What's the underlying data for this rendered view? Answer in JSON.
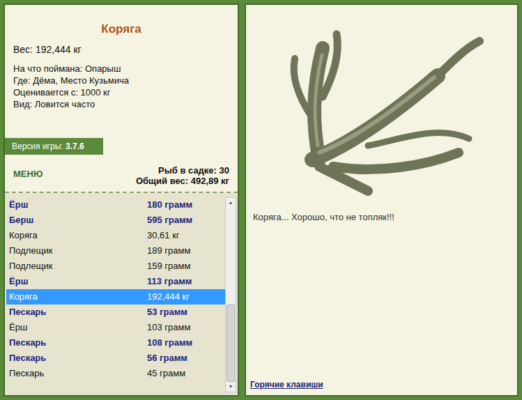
{
  "details": {
    "title": "Коряга",
    "weight": "Вес: 192,444 кг",
    "lines": [
      "На что поймана: Опарыш",
      "Где: Дёма, Место Кузьмича",
      "Оценивается с: 1000 кг",
      "Вид: Ловится часто"
    ]
  },
  "version": {
    "label": "Версия игры:",
    "value": "3.7.6"
  },
  "menu": "МЕНЮ",
  "stats": [
    "Рыб в садке: 30",
    "Общий вес: 492,89 кг"
  ],
  "catch": [
    {
      "name": "Ёрш",
      "weight": "180 грамм",
      "bold": true,
      "selected": false
    },
    {
      "name": "Берш",
      "weight": "595 грамм",
      "bold": true,
      "selected": false
    },
    {
      "name": "Коряга",
      "weight": "30,61 кг",
      "bold": false,
      "selected": false
    },
    {
      "name": "Подлещик",
      "weight": "189 грамм",
      "bold": false,
      "selected": false
    },
    {
      "name": "Подлещик",
      "weight": "159 грамм",
      "bold": false,
      "selected": false
    },
    {
      "name": "Ёрш",
      "weight": "113 грамм",
      "bold": true,
      "selected": false
    },
    {
      "name": "Коряга",
      "weight": "192,444 кг",
      "bold": false,
      "selected": true
    },
    {
      "name": "Пескарь",
      "weight": "53 грамм",
      "bold": true,
      "selected": false
    },
    {
      "name": "Ёрш",
      "weight": "103 грамм",
      "bold": false,
      "selected": false
    },
    {
      "name": "Пескарь",
      "weight": "108 грамм",
      "bold": true,
      "selected": false
    },
    {
      "name": "Пескарь",
      "weight": "56 грамм",
      "bold": true,
      "selected": false
    },
    {
      "name": "Пескарь",
      "weight": "45 грамм",
      "bold": false,
      "selected": false
    }
  ],
  "scrollbar": {
    "up": "▲",
    "down": "▼",
    "start": 0.56,
    "level": 0.44
  },
  "caption": "Коряга... Хорошо, что не топляк!!!",
  "hotkeys": "Горячие клавиши"
}
